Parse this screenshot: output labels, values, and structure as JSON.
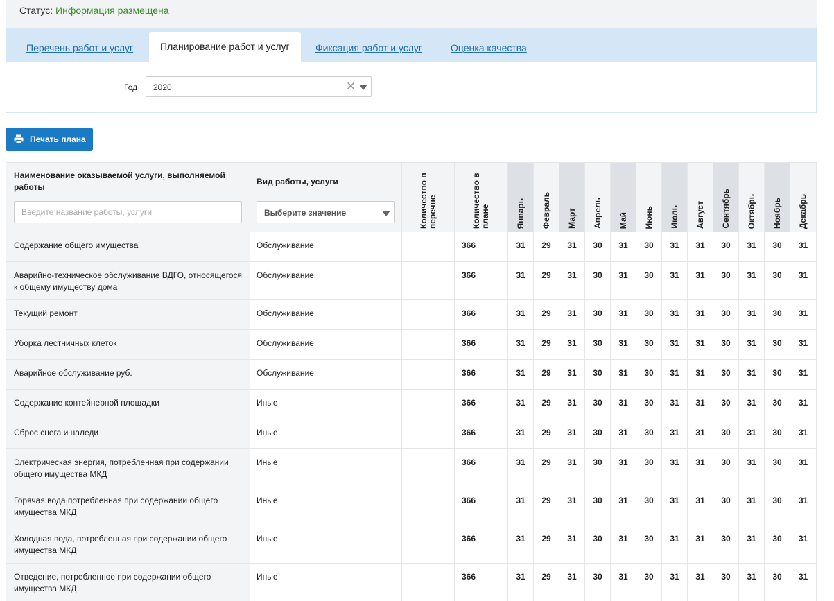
{
  "status": {
    "label": "Статус:",
    "value": "Информация размещена"
  },
  "tabs": [
    {
      "label": "Перечень работ и услуг",
      "active": false
    },
    {
      "label": "Планирование работ и услуг",
      "active": true
    },
    {
      "label": "Фиксация работ и услуг",
      "active": false
    },
    {
      "label": "Оценка качества",
      "active": false
    }
  ],
  "filter": {
    "year_label": "Год",
    "year_value": "2020"
  },
  "print_button": {
    "label": "Печать плана"
  },
  "table": {
    "headers": {
      "name": "Наименование оказываемой услуги, выполняемой работы",
      "name_placeholder": "Введите название работы, услуги",
      "type": "Вид работы, услуги",
      "type_placeholder": "Выберите значение",
      "qty_list": "Количество в перечне",
      "qty_plan": "Количество в плане",
      "months": [
        "Январь",
        "Февраль",
        "Март",
        "Апрель",
        "Май",
        "Июнь",
        "Июль",
        "Август",
        "Сентябрь",
        "Октябрь",
        "Ноябрь",
        "Декабрь"
      ]
    },
    "rows": [
      {
        "name": "Содержание общего имущества",
        "type": "Обслуживание",
        "qty_list": "",
        "plan": "366",
        "months": [
          "31",
          "29",
          "31",
          "30",
          "31",
          "30",
          "31",
          "31",
          "30",
          "31",
          "30",
          "31"
        ]
      },
      {
        "name": "Аварийно-техническое обслуживание ВДГО, относящегося к общему имуществу дома",
        "type": "Обслуживание",
        "qty_list": "",
        "plan": "366",
        "months": [
          "31",
          "29",
          "31",
          "30",
          "31",
          "30",
          "31",
          "31",
          "30",
          "31",
          "30",
          "31"
        ]
      },
      {
        "name": "Текущий ремонт",
        "type": "Обслуживание",
        "qty_list": "",
        "plan": "366",
        "months": [
          "31",
          "29",
          "31",
          "30",
          "31",
          "30",
          "31",
          "31",
          "30",
          "31",
          "30",
          "31"
        ]
      },
      {
        "name": "Уборка лестничных клеток",
        "type": "Обслуживание",
        "qty_list": "",
        "plan": "366",
        "months": [
          "31",
          "29",
          "31",
          "30",
          "31",
          "30",
          "31",
          "31",
          "30",
          "31",
          "30",
          "31"
        ]
      },
      {
        "name": "Аварийное обслуживание руб.",
        "type": "Обслуживание",
        "qty_list": "",
        "plan": "366",
        "months": [
          "31",
          "29",
          "31",
          "30",
          "31",
          "30",
          "31",
          "31",
          "30",
          "31",
          "30",
          "31"
        ]
      },
      {
        "name": "Содержание контейнерной площадки",
        "type": "Иные",
        "qty_list": "",
        "plan": "366",
        "months": [
          "31",
          "29",
          "31",
          "30",
          "31",
          "30",
          "31",
          "31",
          "30",
          "31",
          "30",
          "31"
        ]
      },
      {
        "name": "Сброс снега и наледи",
        "type": "Иные",
        "qty_list": "",
        "plan": "366",
        "months": [
          "31",
          "29",
          "31",
          "30",
          "31",
          "30",
          "31",
          "31",
          "30",
          "31",
          "30",
          "31"
        ]
      },
      {
        "name": "Электрическая энергия, потребленная при содержании общего имущества МКД",
        "type": "Иные",
        "qty_list": "",
        "plan": "366",
        "months": [
          "31",
          "29",
          "31",
          "30",
          "31",
          "30",
          "31",
          "31",
          "30",
          "31",
          "30",
          "31"
        ]
      },
      {
        "name": "Горячая вода,потребленная при содержании общего имущества МКД",
        "type": "Иные",
        "qty_list": "",
        "plan": "366",
        "months": [
          "31",
          "29",
          "31",
          "30",
          "31",
          "30",
          "31",
          "31",
          "30",
          "31",
          "30",
          "31"
        ]
      },
      {
        "name": "Холодная вода, потребленная при содержании общего имущества МКД",
        "type": "Иные",
        "qty_list": "",
        "plan": "366",
        "months": [
          "31",
          "29",
          "31",
          "30",
          "31",
          "30",
          "31",
          "31",
          "30",
          "31",
          "30",
          "31"
        ]
      },
      {
        "name": "Отведение, потребленное при содержании общего имущества МКД",
        "type": "Иные",
        "qty_list": "",
        "plan": "366",
        "months": [
          "31",
          "29",
          "31",
          "30",
          "31",
          "30",
          "31",
          "31",
          "30",
          "31",
          "30",
          "31"
        ]
      }
    ]
  },
  "colors": {
    "accent": "#1a7bc4",
    "status_ok": "#3c8c2e",
    "tab_band": "#d5e7f7",
    "header_bg": "#f2f4f6"
  },
  "icons": {
    "print": "printer-icon",
    "clear": "clear-x-icon",
    "dropdown": "chevron-down-icon"
  }
}
